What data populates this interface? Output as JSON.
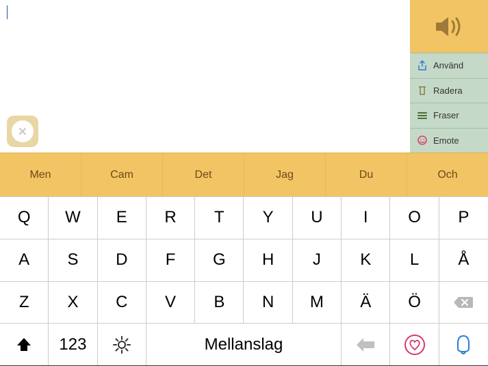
{
  "textArea": {
    "content": ""
  },
  "rightPanel": {
    "actions": [
      {
        "label": "Använd"
      },
      {
        "label": "Radera"
      },
      {
        "label": "Fraser"
      },
      {
        "label": "Emote"
      }
    ]
  },
  "suggestions": [
    "Men",
    "Cam",
    "Det",
    "Jag",
    "Du",
    "Och"
  ],
  "keyboard": {
    "row1": [
      "Q",
      "W",
      "E",
      "R",
      "T",
      "Y",
      "U",
      "I",
      "O",
      "P"
    ],
    "row2": [
      "A",
      "S",
      "D",
      "F",
      "G",
      "H",
      "J",
      "K",
      "L",
      "Å"
    ],
    "row3": [
      "Z",
      "X",
      "C",
      "V",
      "B",
      "N",
      "M",
      "Ä",
      "Ö"
    ],
    "numLabel": "123",
    "spaceLabel": "Mellanslag"
  },
  "colors": {
    "accent": "#f2c463",
    "panel": "#c5d9c8"
  }
}
